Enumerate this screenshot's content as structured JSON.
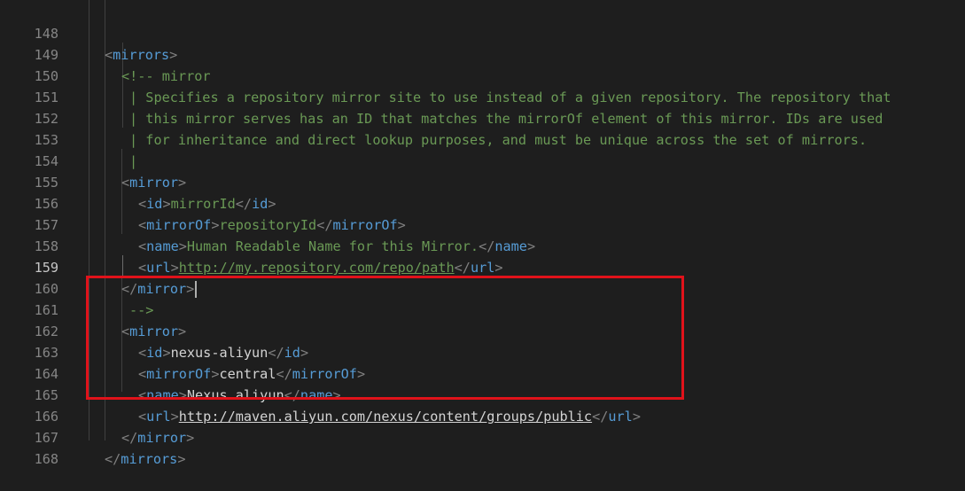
{
  "editor": {
    "line_numbers": [
      "148",
      "149",
      "150",
      "151",
      "152",
      "153",
      "154",
      "155",
      "156",
      "157",
      "158",
      "159",
      "160",
      "161",
      "162",
      "163",
      "164",
      "165",
      "166",
      "167",
      "168"
    ],
    "active_line": "159",
    "lines": {
      "l148": {
        "open": "<",
        "name": "mirrors",
        "close": ">"
      },
      "l149": {
        "text": "<!-- mirror"
      },
      "l150": {
        "bar": "|",
        "text": " Specifies a repository mirror site to use instead of a given repository. The repository that"
      },
      "l151": {
        "bar": "|",
        "text": " this mirror serves has an ID that matches the mirrorOf element of this mirror. IDs are used"
      },
      "l152": {
        "bar": "|",
        "text": " for inheritance and direct lookup purposes, and must be unique across the set of mirrors."
      },
      "l153": {
        "bar": "|"
      },
      "l154": {
        "open": "<",
        "name": "mirror",
        "close": ">"
      },
      "l155": {
        "open": "<",
        "name": "id",
        "close": ">",
        "value": "mirrorId",
        "end_open": "</",
        "end_name": "id",
        "end_close": ">"
      },
      "l156": {
        "open": "<",
        "name": "mirrorOf",
        "close": ">",
        "value": "repositoryId",
        "end_open": "</",
        "end_name": "mirrorOf",
        "end_close": ">"
      },
      "l157": {
        "open": "<",
        "name": "name",
        "close": ">",
        "value": "Human Readable Name for this Mirror.",
        "end_open": "</",
        "end_name": "name",
        "end_close": ">"
      },
      "l158": {
        "open": "<",
        "name": "url",
        "close": ">",
        "value": "http://my.repository.com/repo/path",
        "end_open": "</",
        "end_name": "url",
        "end_close": ">"
      },
      "l159": {
        "open": "</",
        "name": "mirror",
        "close": ">"
      },
      "l160": {
        "text": "-->"
      },
      "l161": {
        "open": "<",
        "name": "mirror",
        "close": ">"
      },
      "l162": {
        "open": "<",
        "name": "id",
        "close": ">",
        "value": "nexus-aliyun",
        "end_open": "</",
        "end_name": "id",
        "end_close": ">"
      },
      "l163": {
        "open": "<",
        "name": "mirrorOf",
        "close": ">",
        "value": "central",
        "end_open": "</",
        "end_name": "mirrorOf",
        "end_close": ">"
      },
      "l164": {
        "open": "<",
        "name": "name",
        "close": ">",
        "value": "Nexus aliyun",
        "end_open": "</",
        "end_name": "name",
        "end_close": ">"
      },
      "l165": {
        "open": "<",
        "name": "url",
        "close": ">",
        "value": "http://maven.aliyun.com/nexus/content/groups/public",
        "end_open": "</",
        "end_name": "url",
        "end_close": ">"
      },
      "l166": {
        "open": "</",
        "name": "mirror",
        "close": ">"
      },
      "l167": {
        "open": "</",
        "name": "mirrors",
        "close": ">"
      }
    }
  },
  "colors": {
    "background": "#1e1e1e",
    "tag": "#569cd6",
    "comment": "#6a9955",
    "text": "#d4d4d4",
    "highlight_box": "#e0121a"
  }
}
